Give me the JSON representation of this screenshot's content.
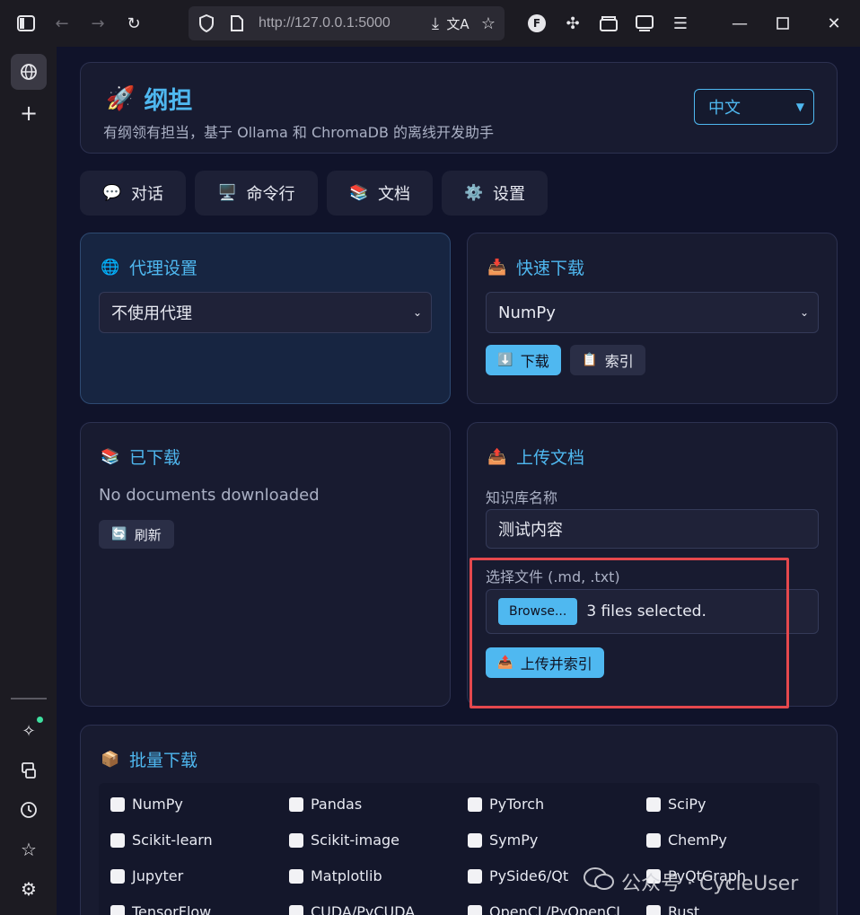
{
  "browser": {
    "url": "http://127.0.0.1:5000"
  },
  "app": {
    "title": "纲担",
    "subtitle": "有纲领有担当，基于 Ollama 和 ChromaDB 的离线开发助手",
    "language": "中文"
  },
  "tabs": [
    {
      "label": "对话",
      "icon": "speech-bubble-icon"
    },
    {
      "label": "命令行",
      "icon": "monitor-icon"
    },
    {
      "label": "文档",
      "icon": "books-icon"
    },
    {
      "label": "设置",
      "icon": "gear-icon"
    }
  ],
  "proxy": {
    "title": "代理设置",
    "selected": "不使用代理"
  },
  "quick_download": {
    "title": "快速下载",
    "selected": "NumPy",
    "download_label": "下载",
    "index_label": "索引"
  },
  "downloaded": {
    "title": "已下载",
    "empty_text": "No documents downloaded",
    "refresh_label": "刷新"
  },
  "upload": {
    "title": "上传文档",
    "kb_label": "知识库名称",
    "kb_value": "测试内容",
    "file_label": "选择文件 (.md, .txt)",
    "browse_label": "Browse...",
    "file_status": "3 files selected.",
    "submit_label": "上传并索引"
  },
  "batch": {
    "title": "批量下载",
    "items": [
      "NumPy",
      "Pandas",
      "PyTorch",
      "SciPy",
      "Scikit-learn",
      "Scikit-image",
      "SymPy",
      "ChemPy",
      "Jupyter",
      "Matplotlib",
      "PySide6/Qt",
      "PyQtGraph",
      "TensorFlow",
      "CUDA/PyCUDA",
      "OpenCL/PyOpenCL",
      "Rust"
    ]
  },
  "watermark": {
    "text": "公众号 · CycleUser"
  },
  "colors": {
    "accent": "#4fb8f0",
    "highlight": "#e5484d"
  }
}
